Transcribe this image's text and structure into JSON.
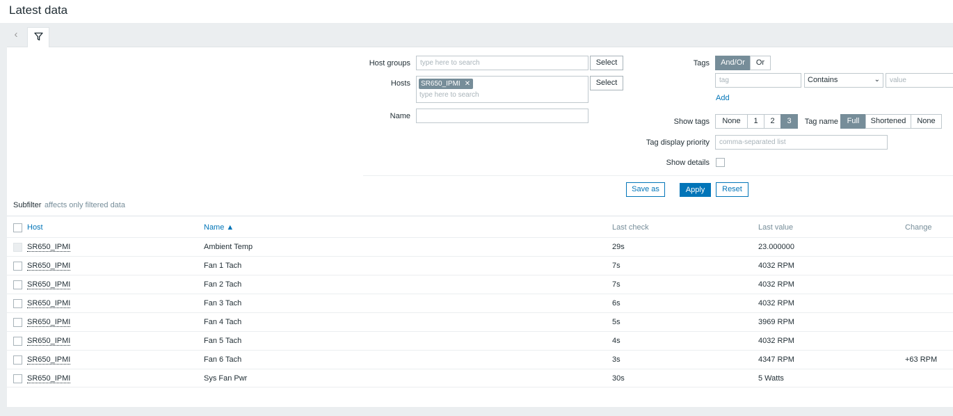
{
  "page": {
    "title": "Latest data"
  },
  "filter": {
    "host_groups": {
      "label": "Host groups",
      "placeholder": "type here to search",
      "select_label": "Select"
    },
    "hosts": {
      "label": "Hosts",
      "chip": "SR650_IPMI",
      "placeholder": "type here to search",
      "select_label": "Select"
    },
    "name": {
      "label": "Name",
      "value": ""
    },
    "tags": {
      "label": "Tags",
      "and_or": "And/Or",
      "or": "Or",
      "tag_placeholder": "tag",
      "operator": "Contains",
      "value_placeholder": "value",
      "add": "Add"
    },
    "show_tags": {
      "label": "Show tags",
      "options": [
        "None",
        "1",
        "2",
        "3"
      ],
      "selected": "3"
    },
    "tag_name": {
      "label": "Tag name",
      "options": [
        "Full",
        "Shortened",
        "None"
      ],
      "selected": "Full"
    },
    "tag_display_priority": {
      "label": "Tag display priority",
      "placeholder": "comma-separated list"
    },
    "show_details": {
      "label": "Show details",
      "checked": false
    },
    "buttons": {
      "save_as": "Save as",
      "apply": "Apply",
      "reset": "Reset"
    }
  },
  "subfilter": {
    "label": "Subfilter",
    "note": "affects only filtered data"
  },
  "table": {
    "headers": {
      "host": "Host",
      "name": "Name ▲",
      "last_check": "Last check",
      "last_value": "Last value",
      "change": "Change"
    },
    "rows": [
      {
        "host": "SR650_IPMI",
        "name": "Ambient Temp",
        "last_check": "29s",
        "last_value": "23.000000",
        "change": "",
        "disabled": true
      },
      {
        "host": "SR650_IPMI",
        "name": "Fan 1 Tach",
        "last_check": "7s",
        "last_value": "4032 RPM",
        "change": ""
      },
      {
        "host": "SR650_IPMI",
        "name": "Fan 2 Tach",
        "last_check": "7s",
        "last_value": "4032 RPM",
        "change": ""
      },
      {
        "host": "SR650_IPMI",
        "name": "Fan 3 Tach",
        "last_check": "6s",
        "last_value": "4032 RPM",
        "change": ""
      },
      {
        "host": "SR650_IPMI",
        "name": "Fan 4 Tach",
        "last_check": "5s",
        "last_value": "3969 RPM",
        "change": ""
      },
      {
        "host": "SR650_IPMI",
        "name": "Fan 5 Tach",
        "last_check": "4s",
        "last_value": "4032 RPM",
        "change": ""
      },
      {
        "host": "SR650_IPMI",
        "name": "Fan 6 Tach",
        "last_check": "3s",
        "last_value": "4347 RPM",
        "change": "+63 RPM"
      },
      {
        "host": "SR650_IPMI",
        "name": "Sys Fan Pwr",
        "last_check": "30s",
        "last_value": "5 Watts",
        "change": ""
      }
    ]
  }
}
